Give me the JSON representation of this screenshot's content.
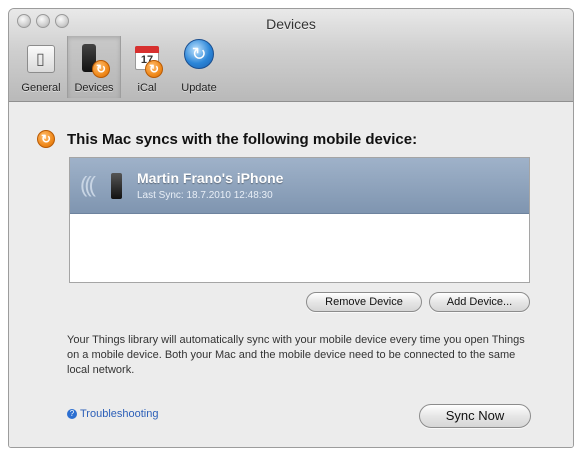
{
  "window": {
    "title": "Devices"
  },
  "toolbar": {
    "items": [
      {
        "label": "General",
        "icon": "general-icon"
      },
      {
        "label": "Devices",
        "icon": "devices-icon",
        "selected": true
      },
      {
        "label": "iCal",
        "icon": "ical-icon",
        "calendar_day": "17"
      },
      {
        "label": "Update",
        "icon": "update-icon"
      }
    ]
  },
  "main": {
    "heading": "This Mac syncs with the following mobile device:",
    "devices": [
      {
        "name": "Martin Frano's iPhone",
        "last_sync": "Last Sync: 18.7.2010 12:48:30",
        "selected": true
      }
    ],
    "remove_button": "Remove Device",
    "add_button": "Add Device...",
    "description": "Your Things library will automatically sync with your mobile device every time you open Things on a mobile device. Both your Mac and the mobile device need to be connected to the same local network.",
    "troubleshooting_link": "Troubleshooting",
    "sync_button": "Sync Now"
  },
  "colors": {
    "accent_orange": "#f08a1c",
    "selection_blue": "#8ea3bd",
    "link_blue": "#2c5fb8"
  }
}
